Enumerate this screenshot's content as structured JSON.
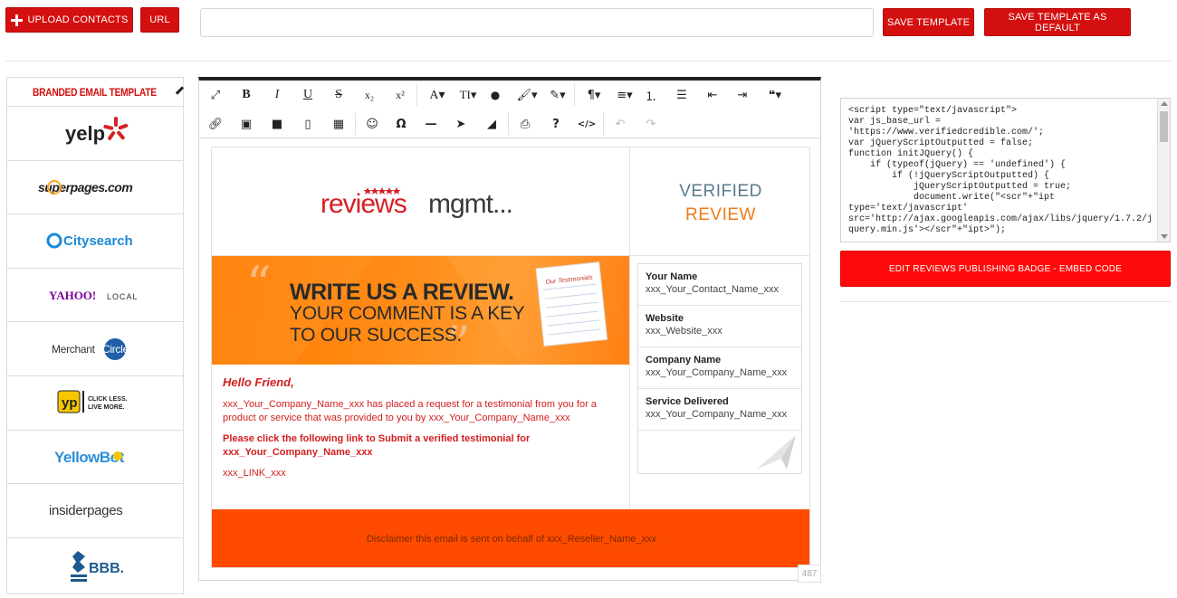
{
  "topbar": {
    "upload_label": "Upload Contacts",
    "url_label": "URL",
    "template_name_value": "",
    "save_label": "Save Template",
    "save_default_label": "Save Template as Default"
  },
  "sidebar": {
    "header_label": "BRANDED EMAIL TEMPLATE",
    "items": [
      {
        "name": "yelp",
        "text": "yelp"
      },
      {
        "name": "superpages",
        "text": "superpages.com"
      },
      {
        "name": "citysearch",
        "text": "Citysearch"
      },
      {
        "name": "yahoo-local",
        "text": "YAHOO!",
        "sub": "LOCAL"
      },
      {
        "name": "merchant-circle",
        "text": "Merchant",
        "sub": "Circle"
      },
      {
        "name": "yp",
        "text": "yp",
        "sub1": "CLICK LESS.",
        "sub2": "LIVE MORE."
      },
      {
        "name": "yellowbot",
        "text": "YellowBot"
      },
      {
        "name": "insiderpages",
        "text": "insiderpages"
      },
      {
        "name": "bbb",
        "text": "BBB."
      }
    ]
  },
  "editor": {
    "toolbar_row1": [
      "fullscreen-icon",
      "bold-icon",
      "italic-icon",
      "underline-icon",
      "strikethrough-icon",
      "subscript-icon",
      "superscript-icon",
      "font-family-icon",
      "font-size-icon",
      "color-icon",
      "paint-brush-icon",
      "magic-wand-icon",
      "paragraph-icon",
      "align-icon",
      "ordered-list-icon",
      "unordered-list-icon",
      "outdent-icon",
      "indent-icon",
      "quote-icon"
    ],
    "toolbar_row2": [
      "link-icon",
      "image-icon",
      "video-icon",
      "file-icon",
      "table-icon",
      "emoji-icon",
      "special-char-icon",
      "horizontal-rule-icon",
      "select-all-icon",
      "clear-format-icon",
      "print-icon",
      "help-icon",
      "code-view-icon",
      "undo-icon",
      "redo-icon"
    ],
    "char_count": "487"
  },
  "email": {
    "logo_text_a": "reviews",
    "logo_text_b": "mgmt...",
    "verified_line1": "VERIFIED",
    "verified_line2": "REVIEW",
    "banner_line1": "WRITE US A REVIEW.",
    "banner_line2": "YOUR COMMENT IS A KEY",
    "banner_line3": "TO OUR SUCCESS.",
    "banner_paper_label": "Our Testimonials",
    "greeting": "Hello Friend,",
    "paragraph1": "xxx_Your_Company_Name_xxx has placed a request for a testimonial from you for a product or service that was provided to you by xxx_Your_Company_Name_xxx",
    "paragraph2": "Please click the following link to Submit a verified testimonial for xxx_Your_Company_Name_xxx",
    "link_placeholder": "xxx_LINK_xxx",
    "fields": [
      {
        "label": "Your Name",
        "value": "xxx_Your_Contact_Name_xxx"
      },
      {
        "label": "Website",
        "value": "xxx_Website_xxx"
      },
      {
        "label": "Company Name",
        "value": "xxx_Your_Company_Name_xxx"
      },
      {
        "label": "Service Delivered",
        "value": "xxx_Your_Company_Name_xxx"
      }
    ],
    "disclaimer": "Disclaimer this email is sent on behalf of xxx_Reseller_Name_xxx"
  },
  "embed": {
    "code": "<script type=\"text/javascript\">\nvar js_base_url =\n'https://www.verifiedcredible.com/';\nvar jQueryScriptOutputted = false;\nfunction initJQuery() {\n    if (typeof(jQuery) == 'undefined') {\n        if (!jQueryScriptOutputted) {\n            jQueryScriptOutputted = true;\n            document.write(\"<scr\"+\"ipt\ntype='text/javascript'\nsrc='http://ajax.googleapis.com/ajax/libs/jquery/1.7.2/jquery.min.js'></scr\"+\"ipt>\");",
    "button_label": "Edit Reviews Publishing Badge - Embed Code"
  },
  "colors": {
    "brand_red": "#d40f0f",
    "banner_orange": "#ff8a14",
    "footer_orange": "#ff4b00",
    "verified_blue": "#5a7a8e",
    "review_orange": "#f07a16"
  }
}
